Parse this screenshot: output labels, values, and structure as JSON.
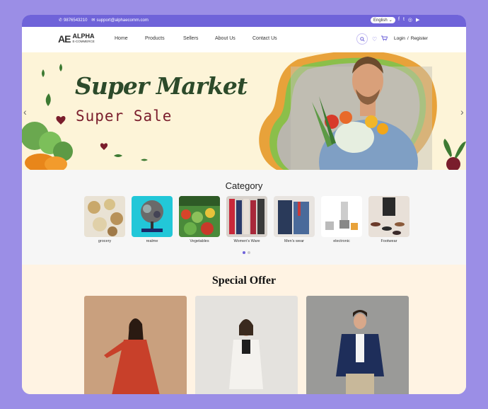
{
  "topbar": {
    "phone": "9876543210",
    "email": "support@alphaecomm.com",
    "language": "English",
    "social_icons": [
      "facebook-icon",
      "twitter-icon",
      "instagram-icon",
      "youtube-icon"
    ]
  },
  "logo": {
    "mark": "AE",
    "name": "ALPHA",
    "tagline": "E-COMMERCE"
  },
  "nav": {
    "items": [
      "Home",
      "Products",
      "Sellers",
      "About Us",
      "Contact Us"
    ],
    "login": "Login",
    "separator": "/",
    "register": "Register"
  },
  "hero": {
    "title": "Super Market",
    "subtitle": "Super Sale"
  },
  "category": {
    "title": "Category",
    "items": [
      {
        "label": "grocery"
      },
      {
        "label": "realme"
      },
      {
        "label": "Vegetables"
      },
      {
        "label": "Women's Ware"
      },
      {
        "label": "Men's wear"
      },
      {
        "label": "electronic"
      },
      {
        "label": "Footwear"
      }
    ],
    "carousel_pages": 2,
    "active_page": 1
  },
  "special_offer": {
    "title": "Special Offer"
  },
  "colors": {
    "brand": "#6f63d9",
    "background": "#9b8ee6",
    "hero_bg": "#fdf4d8",
    "offer_bg": "#fff3e3"
  }
}
